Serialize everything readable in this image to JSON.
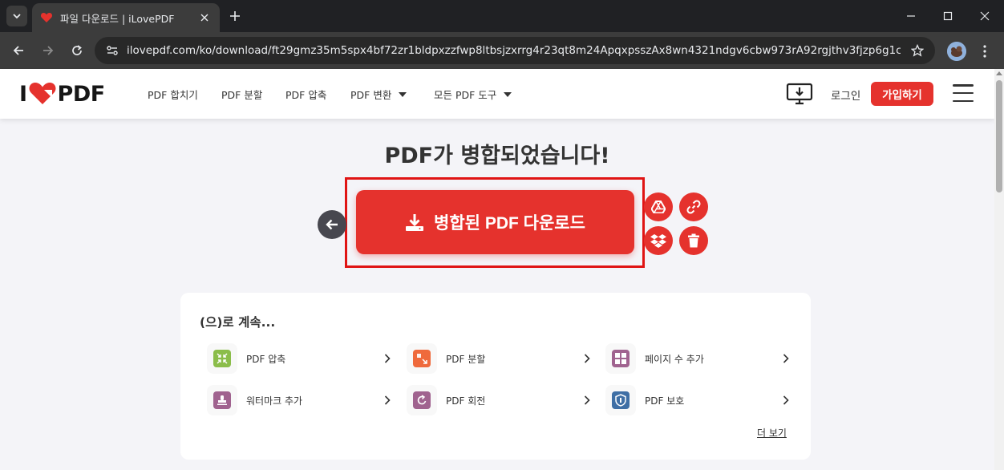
{
  "browser": {
    "tab_title": "파일 다운로드 | iLovePDF",
    "url": "ilovepdf.com/ko/download/ft29gmz35m5spx4bf72zr1bldpxzzfwp8ltbsjzxrrg4r23qt8m24ApqxpsszAx8wn4321ndgv6cbw973rA92rgjthv3fjzp6g1cgss4py4..."
  },
  "header": {
    "logo_text_left": "I",
    "logo_text_right": "PDF",
    "nav": [
      {
        "label": "PDF 합치기"
      },
      {
        "label": "PDF 분할"
      },
      {
        "label": "PDF 압축"
      },
      {
        "label": "PDF 변환"
      },
      {
        "label": "모든 PDF 도구"
      }
    ],
    "login": "로그인",
    "signup": "가입하기"
  },
  "main": {
    "headline": "PDF가 병합되었습니다!",
    "download_label": "병합된 PDF 다운로드"
  },
  "continue": {
    "title": "(으)로 계속...",
    "tools": [
      {
        "label": "PDF 압축",
        "color": "#8bbd4a",
        "icon": "compress-icon"
      },
      {
        "label": "PDF 분할",
        "color": "#ef6a3c",
        "icon": "split-icon"
      },
      {
        "label": "페이지 수 추가",
        "color": "#a0638f",
        "icon": "page-numbers-icon"
      },
      {
        "label": "워터마크 추가",
        "color": "#a0638f",
        "icon": "watermark-icon"
      },
      {
        "label": "PDF 회전",
        "color": "#a0638f",
        "icon": "rotate-icon"
      },
      {
        "label": "PDF 보호",
        "color": "#3f6fa5",
        "icon": "protect-icon"
      }
    ],
    "more": "더 보기"
  },
  "colors": {
    "brand_red": "#e5322d",
    "chrome_dark": "#202124",
    "highlight": "#e01414"
  }
}
